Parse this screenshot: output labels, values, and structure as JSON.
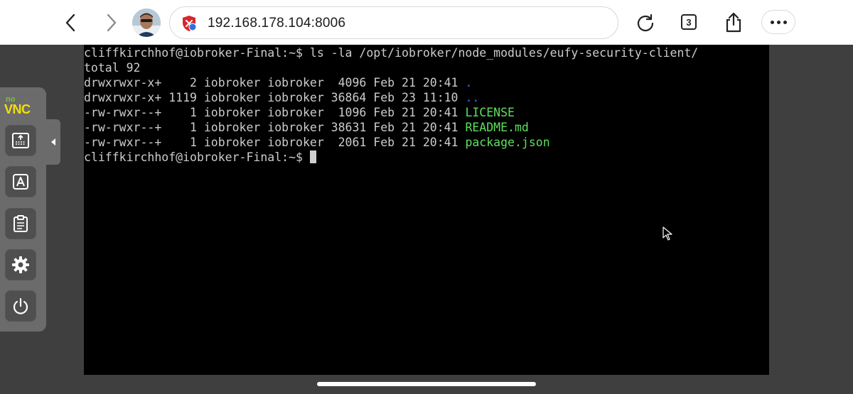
{
  "browser": {
    "url": "192.168.178.104:8006",
    "tab_count": "3",
    "icons": {
      "back": "chevron-left-icon",
      "forward": "chevron-right-icon",
      "site_security": "shield-icon",
      "reload": "reload-icon",
      "share": "share-icon",
      "more": "more-icon"
    }
  },
  "vnc": {
    "logo_no": "no",
    "logo_vnc": "VNC",
    "buttons": [
      {
        "icon": "keyboard-icon",
        "name": "show-keyboard-button"
      },
      {
        "icon": "extra-keys-icon",
        "name": "extra-keys-button"
      },
      {
        "icon": "clipboard-icon",
        "name": "clipboard-button"
      },
      {
        "icon": "gear-icon",
        "name": "settings-button"
      },
      {
        "icon": "power-icon",
        "name": "power-button"
      }
    ],
    "colors": {
      "no": "#7ac142",
      "vnc": "#f4e00a"
    }
  },
  "terminal": {
    "lines": [
      {
        "text": "cliffkirchhof@iobroker-Final:~$ ls -la /opt/iobroker/node_modules/eufy-security-client/",
        "name": ""
      },
      {
        "text": "total 92",
        "name": ""
      },
      {
        "text": "drwxrwxr-x+    2 iobroker iobroker  4096 Feb 21 20:41 ",
        "name": "."
      },
      {
        "text": "drwxrwxr-x+ 1119 iobroker iobroker 36864 Feb 23 11:10 ",
        "name": ".."
      },
      {
        "text": "-rw-rwxr--+    1 iobroker iobroker  1096 Feb 21 20:41 ",
        "name": "LICENSE"
      },
      {
        "text": "-rw-rwxr--+    1 iobroker iobroker 38631 Feb 21 20:41 ",
        "name": "README.md"
      },
      {
        "text": "-rw-rwxr--+    1 iobroker iobroker  2061 Feb 21 20:41 ",
        "name": "package.json"
      }
    ],
    "prompt": "cliffkirchhof@iobroker-Final:~$ ",
    "colors": {
      "text": "#cccccc",
      "dir": "#3a6cf2",
      "file": "#5ce05c",
      "background": "#000000"
    }
  }
}
